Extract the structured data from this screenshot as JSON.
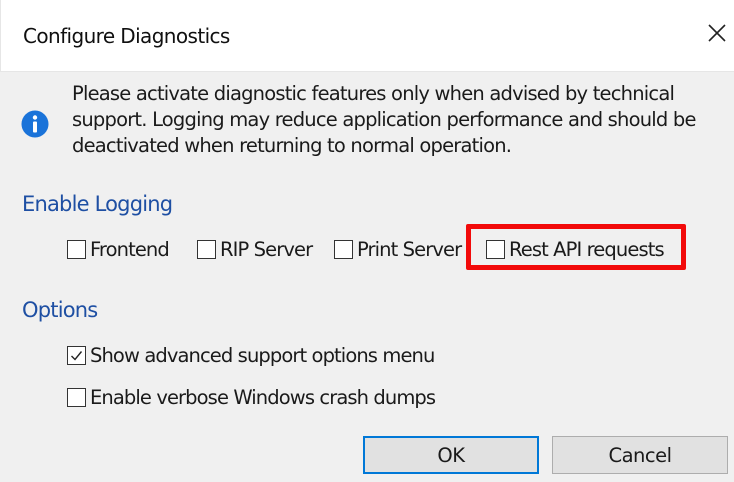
{
  "dialog": {
    "title": "Configure Diagnostics",
    "close_icon": "close-icon",
    "info_icon": "info-icon",
    "message": "Please activate diagnostic features only when advised by technical support. Logging may reduce application performance and should be deactivated when returning to normal operation."
  },
  "logging": {
    "heading": "Enable Logging",
    "items": [
      {
        "label": "Frontend",
        "checked": false
      },
      {
        "label": "RIP Server",
        "checked": false
      },
      {
        "label": "Print Server",
        "checked": false
      },
      {
        "label": "Rest API requests",
        "checked": false
      }
    ]
  },
  "options": {
    "heading": "Options",
    "items": [
      {
        "label": "Show advanced support options menu",
        "checked": true
      },
      {
        "label": "Enable verbose Windows crash dumps",
        "checked": false
      }
    ]
  },
  "buttons": {
    "ok": "OK",
    "cancel": "Cancel"
  },
  "colors": {
    "heading": "#1e4fa3",
    "info": "#1a73d9",
    "highlight": "#f20a0a",
    "default_button_border": "#0078d7"
  }
}
